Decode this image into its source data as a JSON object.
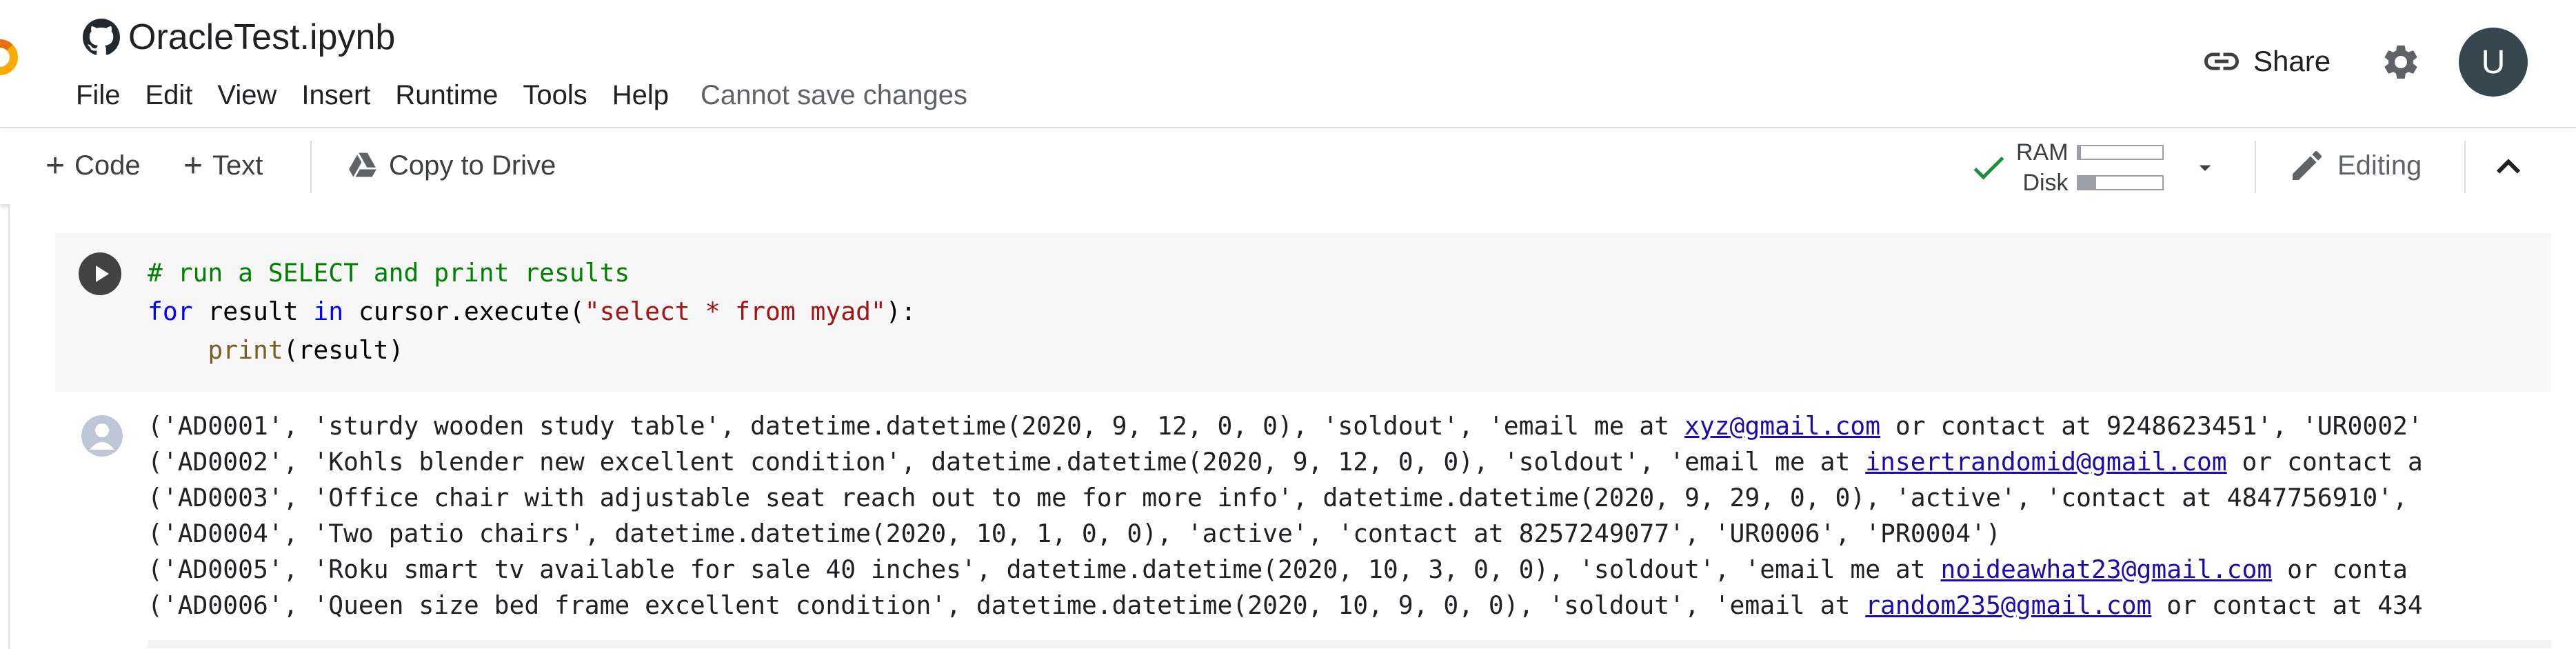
{
  "header": {
    "title": "OracleTest.ipynb",
    "menu": [
      "File",
      "Edit",
      "View",
      "Insert",
      "Runtime",
      "Tools",
      "Help"
    ],
    "save_status": "Cannot save changes",
    "share_label": "Share",
    "avatar_letter": "U"
  },
  "toolbar": {
    "code_label": "Code",
    "text_label": "Text",
    "copy_to_drive_label": "Copy to Drive",
    "ram_label": "RAM",
    "disk_label": "Disk",
    "ram_usage": 0.04,
    "disk_usage": 0.22,
    "editing_label": "Editing"
  },
  "cell": {
    "code_lines": [
      [
        {
          "t": "# run a SELECT and print results",
          "c": "comment"
        }
      ],
      [
        {
          "t": "for",
          "c": "kw"
        },
        {
          "t": " result ",
          "c": ""
        },
        {
          "t": "in",
          "c": "kw"
        },
        {
          "t": " cursor.execute(",
          "c": ""
        },
        {
          "t": "\"select * from myad\"",
          "c": "str"
        },
        {
          "t": "):",
          "c": ""
        }
      ],
      [
        {
          "t": "    ",
          "c": ""
        },
        {
          "t": "print",
          "c": "fn"
        },
        {
          "t": "(result)",
          "c": ""
        }
      ]
    ],
    "output_lines": [
      [
        {
          "t": "('AD0001', 'sturdy wooden study table', datetime.datetime(2020, 9, 12, 0, 0), 'soldout', 'email me at "
        },
        {
          "t": "xyz@gmail.com",
          "link": true
        },
        {
          "t": " or contact at 9248623451', 'UR0002'"
        }
      ],
      [
        {
          "t": "('AD0002', 'Kohls blender new excellent condition', datetime.datetime(2020, 9, 12, 0, 0), 'soldout', 'email me at "
        },
        {
          "t": "insertrandomid@gmail.com",
          "link": true
        },
        {
          "t": " or contact a"
        }
      ],
      [
        {
          "t": "('AD0003', 'Office chair with adjustable seat reach out to me for more info', datetime.datetime(2020, 9, 29, 0, 0), 'active', 'contact at 4847756910', "
        }
      ],
      [
        {
          "t": "('AD0004', 'Two patio chairs', datetime.datetime(2020, 10, 1, 0, 0), 'active', 'contact at 8257249077', 'UR0006', 'PR0004')"
        }
      ],
      [
        {
          "t": "('AD0005', 'Roku smart tv available for sale 40 inches', datetime.datetime(2020, 10, 3, 0, 0), 'soldout', 'email me at "
        },
        {
          "t": "noideawhat23@gmail.com",
          "link": true
        },
        {
          "t": " or conta"
        }
      ],
      [
        {
          "t": "('AD0006', 'Queen size bed frame excellent condition', datetime.datetime(2020, 10, 9, 0, 0), 'soldout', 'email at "
        },
        {
          "t": "random235@gmail.com",
          "link": true
        },
        {
          "t": " or contact at 434"
        }
      ]
    ]
  },
  "colors": {
    "accent_check": "#1e8e3e",
    "link": "#1a0dab",
    "avatar_bg": "#37474f"
  },
  "icons": [
    "colab-logo-icon",
    "github-icon",
    "link-icon",
    "gear-icon",
    "plus-icon",
    "drive-icon",
    "check-icon",
    "chevron-down-icon",
    "pencil-icon",
    "chevron-up-icon",
    "play-icon",
    "user-icon"
  ]
}
